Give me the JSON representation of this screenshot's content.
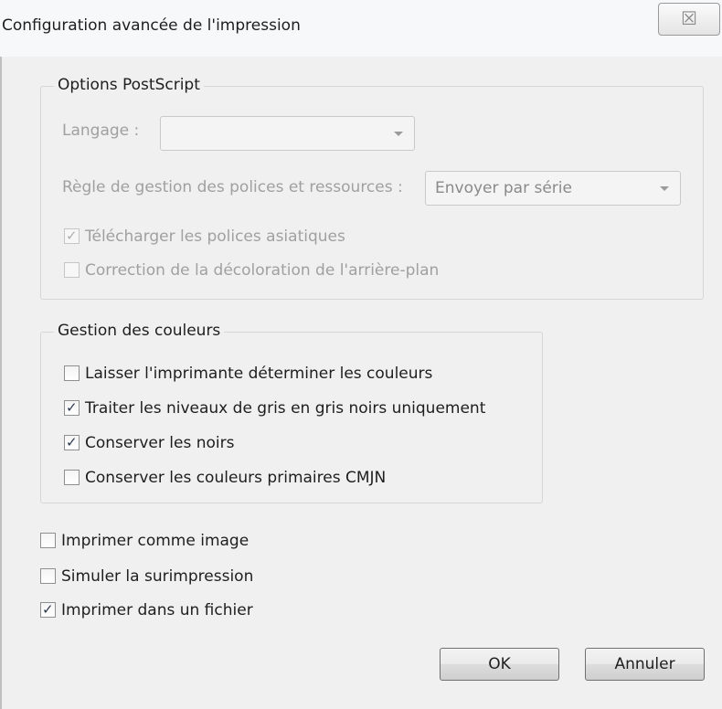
{
  "window": {
    "title": "Configuration avancée de l'impression",
    "close_glyph": "☒"
  },
  "postscript": {
    "legend": "Options PostScript",
    "language_label": "Langage :",
    "language_value": "",
    "font_policy_label": "Règle de gestion des polices et ressources :",
    "font_policy_value": "Envoyer par série",
    "download_asian_fonts": {
      "label": "Télécharger les polices asiatiques",
      "checked": true,
      "enabled": false
    },
    "bg_discoloration_fix": {
      "label": "Correction de la décoloration de l'arrière-plan",
      "checked": false,
      "enabled": false
    }
  },
  "color_management": {
    "legend": "Gestion des couleurs",
    "items": [
      {
        "label": "Laisser l'imprimante déterminer les couleurs",
        "checked": false
      },
      {
        "label": "Traiter les niveaux de gris en gris noirs uniquement",
        "checked": true
      },
      {
        "label": "Conserver les noirs",
        "checked": true
      },
      {
        "label": "Conserver les couleurs primaires CMJN",
        "checked": false
      }
    ]
  },
  "options": [
    {
      "label": "Imprimer comme image",
      "checked": false
    },
    {
      "label": "Simuler la surimpression",
      "checked": false
    },
    {
      "label": "Imprimer dans un fichier",
      "checked": true
    }
  ],
  "buttons": {
    "ok": "OK",
    "cancel": "Annuler"
  },
  "check_glyph": "✓",
  "icons": {
    "close": "close-icon",
    "dropdown": "chevron-down-icon",
    "check": "checkmark-icon"
  }
}
